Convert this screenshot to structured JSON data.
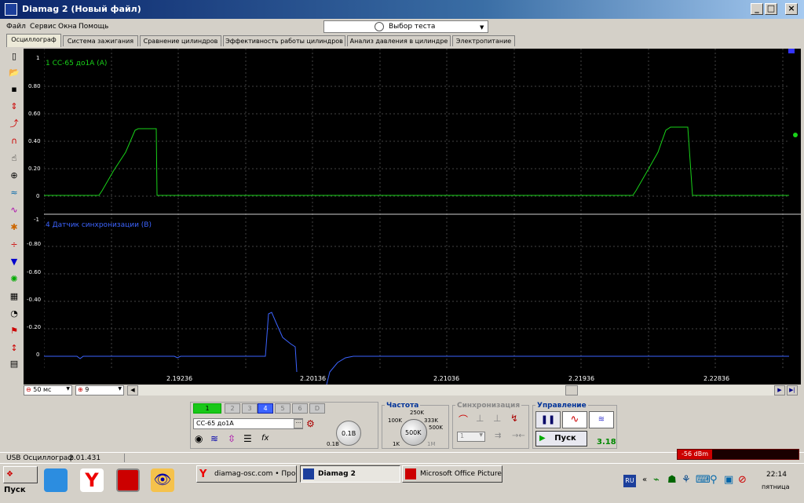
{
  "window": {
    "title": "Diamag 2 (Новый файл)"
  },
  "menu": {
    "items": [
      "Файл",
      "Сервис",
      "Окна",
      "Помощь"
    ]
  },
  "test_select": {
    "label": "Выбор теста"
  },
  "tabs": [
    "Осциллограф",
    "Система зажигания",
    "Сравнение цилиндров",
    "Эффективность работы цилиндров",
    "Анализ давления в цилиндре",
    "Электропитание"
  ],
  "channel_a": {
    "label": "1 СС-65 до1А  (А)",
    "color": "#19d219",
    "ticks": [
      "1",
      "0.80",
      "0.60",
      "0.40",
      "0.20",
      "0"
    ]
  },
  "channel_b": {
    "label": "4 Датчик синхронизации (В)",
    "color": "#3c64ff",
    "ticks": [
      "-1",
      "-0.80",
      "-0.60",
      "-0.40",
      "-0.20",
      "0"
    ]
  },
  "time_ticks": [
    "2.19236",
    "2.20136",
    "2.21036",
    "2.21936",
    "2.22836"
  ],
  "timebase": {
    "value": "50 мс"
  },
  "trigger_channel": {
    "value": "9"
  },
  "channels": {
    "buttons": [
      "1",
      "2",
      "3",
      "4",
      "5",
      "6",
      "D"
    ],
    "active": [
      "1",
      "4"
    ]
  },
  "sensor": {
    "value": "СС-65 до1А"
  },
  "voltage": {
    "knob": "0.1В",
    "label": "0.1В"
  },
  "frequency": {
    "title": "Частота",
    "labels": [
      "250K",
      "100K",
      "333K",
      "500K",
      "1K",
      "1M"
    ],
    "knob": "500K"
  },
  "sync": {
    "title": "Синхронизация",
    "value": "1"
  },
  "control": {
    "title": "Управление",
    "start": "Пуск",
    "version": "3.18"
  },
  "status": {
    "device": "USB Осциллограф",
    "version": "2.01.431",
    "signal": "-56 dBm"
  },
  "taskbar": {
    "start": "Пуск",
    "tasks": [
      "diamag-osc.com • Прос...",
      "Diamag 2",
      "Microsoft Office Picture..."
    ],
    "lang": "RU",
    "time": "22:14",
    "day": "пятница"
  }
}
